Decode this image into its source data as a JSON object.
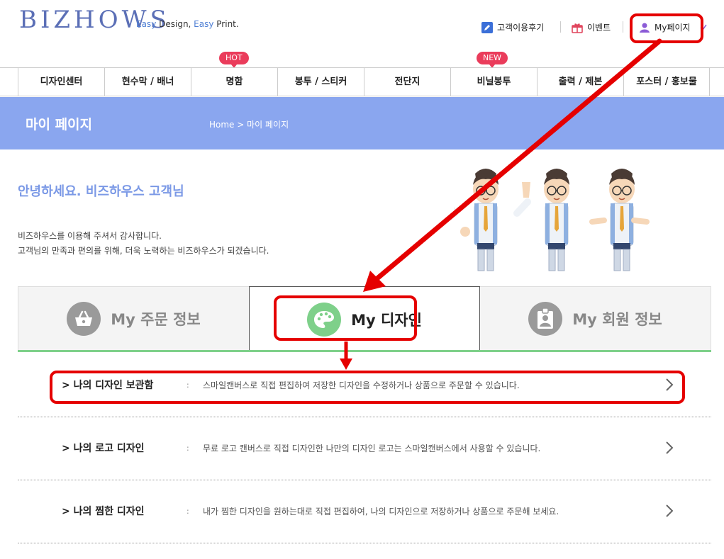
{
  "header": {
    "logo": "BIZHOWS",
    "tagline": {
      "easy1": "Easy",
      "design": " Design, ",
      "easy2": "Easy",
      "print": " Print."
    },
    "links": {
      "reviews": "고객이용후기",
      "event": "이벤트",
      "mypage": "My페이지"
    }
  },
  "nav": {
    "items": [
      "디자인센터",
      "현수막 / 배너",
      "명함",
      "봉투 / 스티커",
      "전단지",
      "비닐봉투",
      "출력 / 제본",
      "포스터 / 홍보물"
    ],
    "badges": {
      "hot": "HOT",
      "new": "NEW"
    }
  },
  "banner": {
    "title": "마이 페이지",
    "breadcrumb": "Home > 마이 페이지"
  },
  "greeting": {
    "title": "안녕하세요. 비즈하우스 고객님",
    "line1": "비즈하우스를 이용해 주셔서 감사합니다.",
    "line2": "고객님의 만족과 편의를 위해, 더욱 노력하는 비즈하우스가 되겠습니다."
  },
  "tabs": [
    {
      "label": "My 주문 정보",
      "icon": "basket-icon"
    },
    {
      "label": "My 디자인",
      "icon": "palette-icon"
    },
    {
      "label": "My 회원 정보",
      "icon": "id-card-icon"
    }
  ],
  "rows": [
    {
      "title": "> 나의 디자인 보관함",
      "colon": ":",
      "desc": "스마일캔버스로 직접 편집하여 저장한 디자인을 수정하거나 상품으로 주문할 수 있습니다."
    },
    {
      "title": "> 나의 로고 디자인",
      "colon": ":",
      "desc": "무료 로고 캔버스로 직접 디자인한 나만의 디자인 로고는 스마일캔버스에서 사용할 수 있습니다."
    },
    {
      "title": "> 나의 찜한 디자인",
      "colon": ":",
      "desc": "내가 찜한 디자인을 원하는대로 직접 편집하여, 나의 디자인으로 저장하거나 상품으로 주문해 보세요."
    }
  ],
  "colors": {
    "accent": "#8aa6ef",
    "green": "#7ed08a",
    "annotation": "#e50000",
    "badge": "#ea3c5b"
  }
}
